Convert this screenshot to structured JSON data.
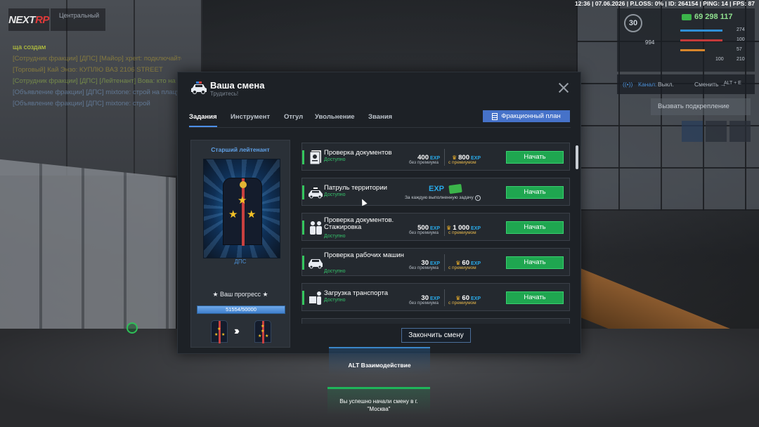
{
  "sysbar": "12:36 | 07.06.2026 | P.LOSS: 0% | ID: 264154 | PING: 14 | FPS: 87",
  "logo": {
    "main": "NEXT",
    "accent": "RP"
  },
  "server": "Центральный",
  "chat": [
    "ща создам",
    "[Сотрудник фракции] [ДПС] [Майор] xpert: подключайтесь к смене",
    "[Торговый] Кай Энзо: КУПЛЮ ВАЗ 2106 STREET",
    "[Сотрудник фракции] [ДПС] [Лейтенант] Вова: кто на смену",
    "[Объявление фракции] [ДПС] mixtone: строй на плацу через 5 минут",
    "[Объявление фракции] [ДПС] mixtone: строй"
  ],
  "hud": {
    "level": "30",
    "money": "69 298 117",
    "left_value": "994",
    "stat_values": [
      "274",
      "100",
      "57",
      "100",
      "210"
    ]
  },
  "radio": {
    "channel_label": "Канал:",
    "channel_value": "Выкл.",
    "change_label": "Сменить →",
    "keys": "ALT + E"
  },
  "backup_button": "Вызвать подкрепление",
  "modal": {
    "title": "Ваша смена",
    "subtitle": "Трудитесь!",
    "tabs": [
      "Задания",
      "Инструмент",
      "Отгул",
      "Увольнение",
      "Звания"
    ],
    "faction_plan": "Фракционный план",
    "finish_button": "Закончить смену"
  },
  "rank": {
    "name": "Старший лейтенант",
    "department": "ДПС",
    "progress_label": "★ Ваш прогресс ★",
    "progress_text": "51554/50000",
    "progress_fraction": 1.0
  },
  "tasks": [
    {
      "name": "Проверка документов",
      "status": "Доступно",
      "exp": "400",
      "exp_premium": "800",
      "sub": "без премиума",
      "sub_premium": "с премиумом",
      "button": "Начать",
      "icon": "document-icon"
    },
    {
      "name": "Патруль территории",
      "status": "Доступно",
      "note": "За каждую выполненную задачу",
      "exp_tag": "EXP",
      "button": "Начать",
      "icon": "patrol-car-icon"
    },
    {
      "name": "Проверка документов. Стажировка",
      "status": "Доступно",
      "exp": "500",
      "exp_premium": "1 000",
      "sub": "без премиума",
      "sub_premium": "с премиумом",
      "button": "Начать",
      "icon": "officers-icon"
    },
    {
      "name": "Проверка рабочих машин",
      "status": "Доступно",
      "exp": "30",
      "exp_premium": "60",
      "sub": "без премиума",
      "sub_premium": "с премиумом",
      "button": "Начать",
      "icon": "work-car-icon"
    },
    {
      "name": "Загрузка транспорта",
      "status": "Доступно",
      "exp": "30",
      "exp_premium": "60",
      "sub": "без премиума",
      "sub_premium": "с премиумом",
      "button": "Начать",
      "icon": "loading-icon"
    }
  ],
  "exp_tag": "EXP",
  "interact_prompt": "ALT Взаимодействие",
  "notice": "Вы успешно начали смену в г. \"Москва\""
}
